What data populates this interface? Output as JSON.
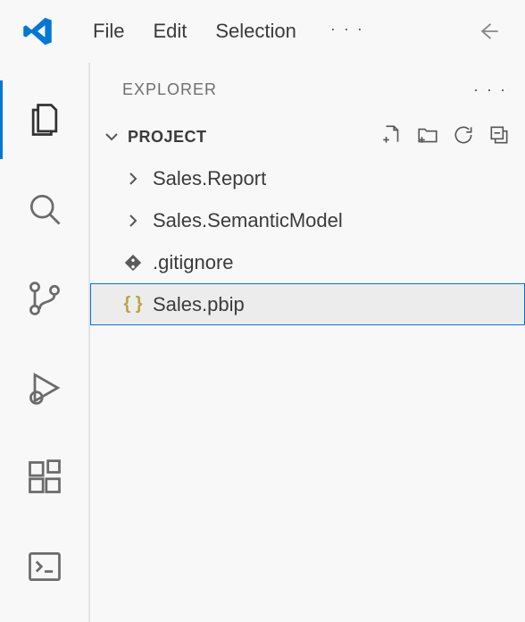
{
  "menubar": {
    "file": "File",
    "edit": "Edit",
    "selection": "Selection"
  },
  "sidebar": {
    "title": "EXPLORER",
    "section": "PROJECT"
  },
  "tree": {
    "items": [
      {
        "label": "Sales.Report"
      },
      {
        "label": "Sales.SemanticModel"
      },
      {
        "label": ".gitignore"
      },
      {
        "label": "Sales.pbip"
      }
    ]
  }
}
